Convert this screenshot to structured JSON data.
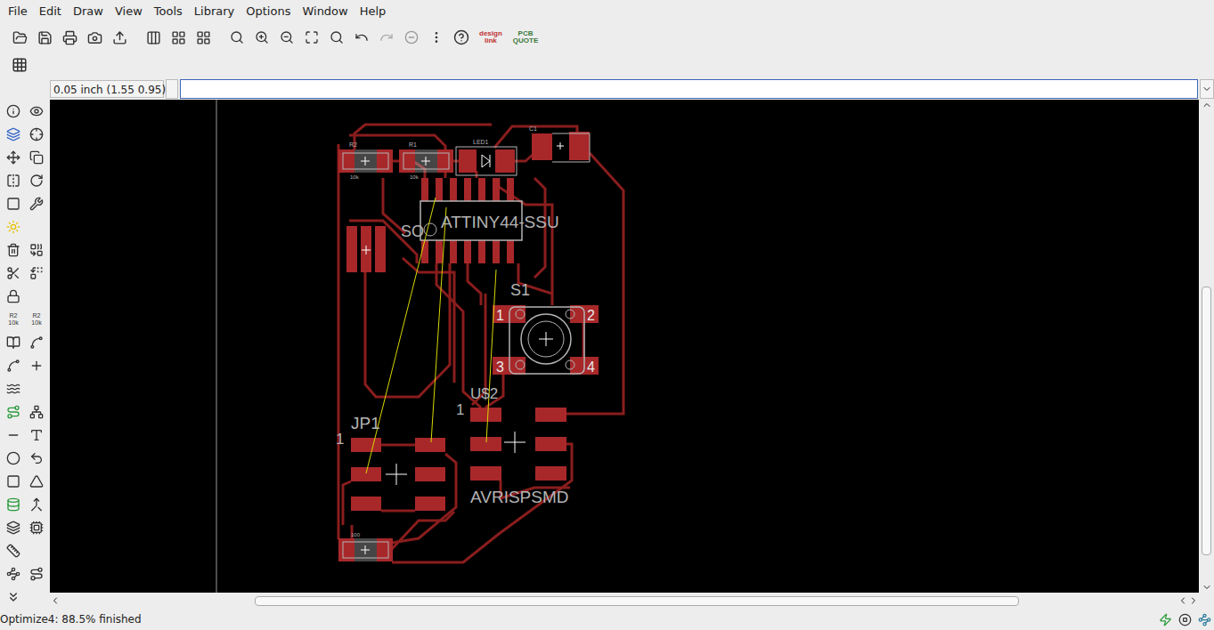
{
  "window": {
    "title": "EAGLE Board Editor"
  },
  "menu": [
    "File",
    "Edit",
    "Draw",
    "View",
    "Tools",
    "Library",
    "Options",
    "Window",
    "Help"
  ],
  "toolbar": {
    "logos": [
      {
        "lines": [
          "design",
          "link"
        ]
      },
      {
        "lines": [
          "PCB",
          "QUOTE"
        ]
      }
    ]
  },
  "command": {
    "coordinates": "0.05 inch (1.55 0.95)",
    "value": ""
  },
  "palette": {
    "labels": [
      {
        "top": "R2",
        "bottom": "10k"
      },
      {
        "top": "R2",
        "bottom": "10k"
      }
    ]
  },
  "board": {
    "labels": [
      "R2",
      "10k",
      "R1",
      "10k",
      "LED1",
      "C1",
      "ATTINY44-SSU",
      "S1",
      "U$2",
      "1",
      "AVRISPSMD",
      "JP1",
      "1",
      "100"
    ],
    "pad_numbers": [
      "1",
      "2",
      "3",
      "4"
    ]
  },
  "status_bar": "Optimize4: 88.5% finished"
}
